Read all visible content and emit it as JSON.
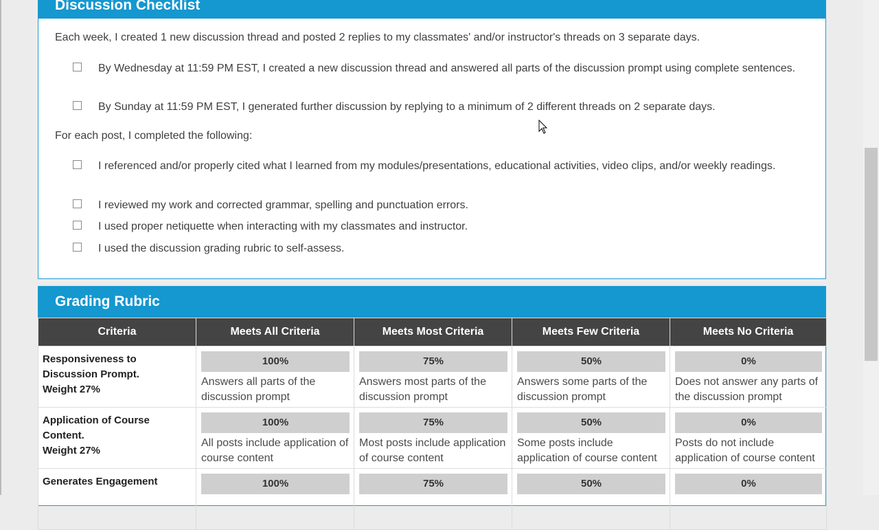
{
  "checklist": {
    "title": "Discussion Checklist",
    "intro": "Each week, I created 1 new discussion thread and posted 2 replies to my classmates' and/or instructor's threads on 3 separate days.",
    "weekly_items": [
      "By Wednesday at 11:59 PM EST, I created a new discussion thread and answered all parts of the discussion prompt using complete sentences.",
      "By Sunday at 11:59 PM EST, I generated further discussion by replying to a minimum of 2 different threads on 2 separate days."
    ],
    "post_intro": "For each post, I completed the following:",
    "post_items": [
      "I referenced and/or properly cited what I learned from my modules/presentations, educational activities, video clips, and/or weekly readings.",
      "I reviewed my work and corrected grammar, spelling and punctuation errors.",
      "I used proper netiquette when interacting with my classmates and instructor.",
      "I used the discussion grading rubric to self-assess."
    ]
  },
  "rubric": {
    "title": "Grading Rubric",
    "headers": [
      "Criteria",
      "Meets All Criteria",
      "Meets Most Criteria",
      "Meets Few Criteria",
      "Meets No Criteria"
    ],
    "rows": [
      {
        "criteria": "Responsiveness to Discussion Prompt.",
        "weight": "Weight 27%",
        "cells": [
          {
            "pct": "100%",
            "desc": "Answers all parts of the discussion prompt"
          },
          {
            "pct": "75%",
            "desc": "Answers most parts of the discussion prompt"
          },
          {
            "pct": "50%",
            "desc": "Answers some parts of the discussion prompt"
          },
          {
            "pct": "0%",
            "desc": "Does not answer any parts of the discussion prompt"
          }
        ]
      },
      {
        "criteria": "Application of Course Content.",
        "weight": "Weight 27%",
        "cells": [
          {
            "pct": "100%",
            "desc": "All posts include application of course content"
          },
          {
            "pct": "75%",
            "desc": "Most posts include application of course content"
          },
          {
            "pct": "50%",
            "desc": "Some posts include application of course content"
          },
          {
            "pct": "0%",
            "desc": "Posts do not include application of course content"
          }
        ]
      },
      {
        "criteria": "Generates Engagement",
        "weight": "",
        "cells": [
          {
            "pct": "100%",
            "desc": ""
          },
          {
            "pct": "75%",
            "desc": ""
          },
          {
            "pct": "50%",
            "desc": ""
          },
          {
            "pct": "0%",
            "desc": ""
          }
        ]
      }
    ]
  },
  "colors": {
    "accent": "#1597cf",
    "header_dark": "#444444",
    "pct_bg": "#cfcfcf"
  }
}
